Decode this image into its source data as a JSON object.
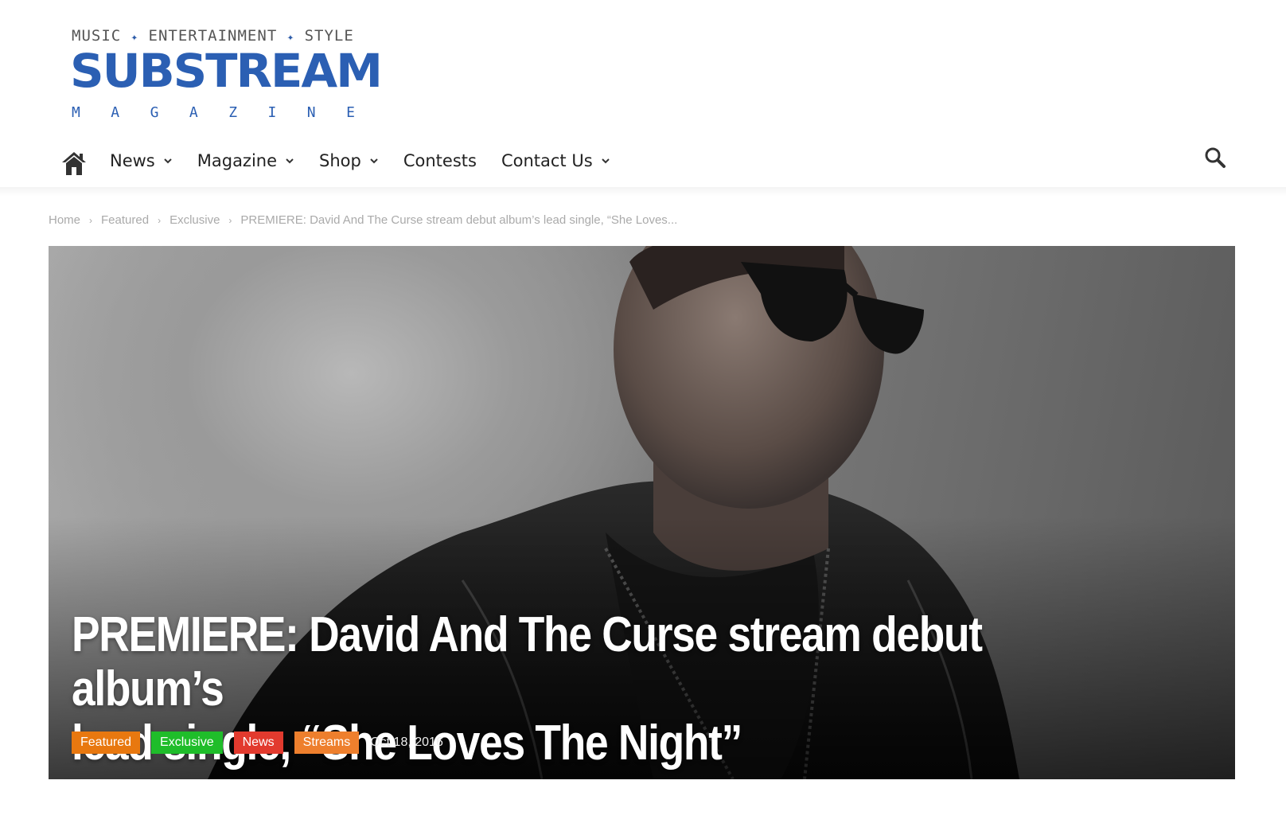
{
  "logo": {
    "tagline_1": "MUSIC",
    "tagline_2": "ENTERTAINMENT",
    "tagline_3": "STYLE",
    "wordmark": "SUBSTREAM",
    "magazine_letters": [
      "M",
      "A",
      "G",
      "A",
      "Z",
      "I",
      "N",
      "E"
    ],
    "brand_color": "#2b5fb3"
  },
  "nav": {
    "items": [
      {
        "label": "News",
        "has_dropdown": true
      },
      {
        "label": "Magazine",
        "has_dropdown": true
      },
      {
        "label": "Shop",
        "has_dropdown": true
      },
      {
        "label": "Contests",
        "has_dropdown": false
      },
      {
        "label": "Contact Us",
        "has_dropdown": true
      }
    ],
    "home_icon": "home-icon",
    "search_icon": "search-icon"
  },
  "breadcrumb": {
    "items": [
      "Home",
      "Featured",
      "Exclusive",
      "PREMIERE: David And The Curse stream debut album’s lead single, “She Loves..."
    ]
  },
  "article": {
    "title_line_1": "PREMIERE: David And The Curse stream debut album’s",
    "title_line_2": "lead single, “She Loves The Night”",
    "tags": [
      {
        "label": "Featured",
        "color": "#e8780f"
      },
      {
        "label": "Exclusive",
        "color": "#1fbd2a"
      },
      {
        "label": "News",
        "color": "#e23a2e"
      },
      {
        "label": "Streams",
        "color": "#ee7f2d"
      }
    ],
    "date": "Oct 18, 2016"
  }
}
